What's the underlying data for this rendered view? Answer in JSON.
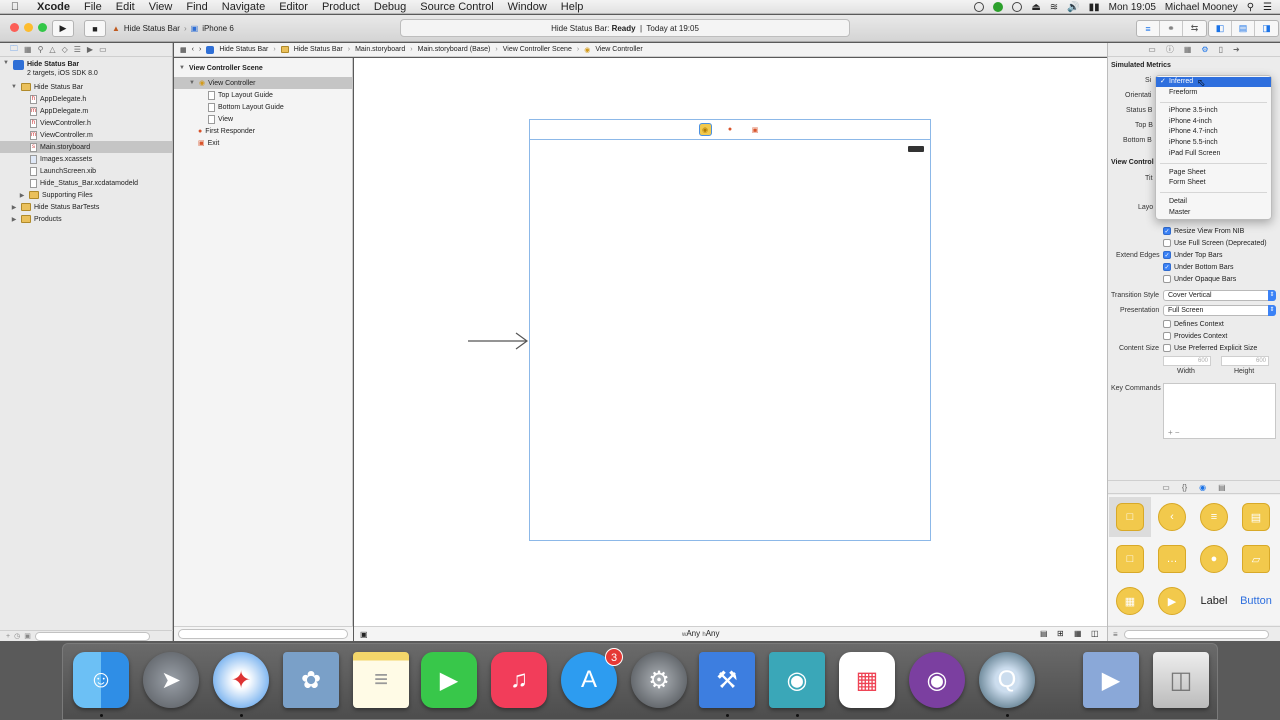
{
  "menubar": {
    "app_name": "Xcode",
    "items": [
      "File",
      "Edit",
      "View",
      "Find",
      "Navigate",
      "Editor",
      "Product",
      "Debug",
      "Source Control",
      "Window",
      "Help"
    ],
    "clock": "Mon 19:05",
    "user": "Michael Mooney"
  },
  "toolbar": {
    "scheme": "Hide Status Bar",
    "device": "iPhone 6",
    "activity_project": "Hide Status Bar:",
    "activity_status": "Ready",
    "activity_time": "Today at 19:05"
  },
  "navigator": {
    "project_name": "Hide Status Bar",
    "project_sub": "2 targets, iOS SDK 8.0",
    "group": "Hide Status Bar",
    "files": [
      "AppDelegate.h",
      "AppDelegate.m",
      "ViewController.h",
      "ViewController.m",
      "Main.storyboard",
      "Images.xcassets",
      "LaunchScreen.xib",
      "Hide_Status_Bar.xcdatamodeld"
    ],
    "folders": [
      "Supporting Files",
      "Hide Status BarTests",
      "Products"
    ]
  },
  "jumpbar": {
    "crumbs": [
      "Hide Status Bar",
      "Hide Status Bar",
      "Main.storyboard",
      "Main.storyboard (Base)",
      "View Controller Scene",
      "View Controller"
    ]
  },
  "outline": {
    "scene": "View Controller Scene",
    "controller": "View Controller",
    "children": [
      "Top Layout Guide",
      "Bottom Layout Guide",
      "View"
    ],
    "first_responder": "First Responder",
    "exit": "Exit"
  },
  "size_class": {
    "w": "w",
    "w_value": "Any",
    "h": "h",
    "h_value": "Any"
  },
  "inspector": {
    "simulated_metrics": "Simulated Metrics",
    "labels_hidden": [
      "Si",
      "Orientati",
      "Status B",
      "Top B",
      "Bottom B"
    ],
    "view_controller": "View Control",
    "title_label": "Tit",
    "layout_label": "Layo",
    "resize_from_nib": "Resize View From NIB",
    "use_full_screen": "Use Full Screen (Deprecated)",
    "extend_edges": "Extend Edges",
    "under_top_bars": "Under Top Bars",
    "under_bottom_bars": "Under Bottom Bars",
    "under_opaque_bars": "Under Opaque Bars",
    "transition_style_label": "Transition Style",
    "transition_style": "Cover Vertical",
    "presentation_label": "Presentation",
    "presentation": "Full Screen",
    "defines_context": "Defines Context",
    "provides_context": "Provides Context",
    "content_size_label": "Content Size",
    "use_preferred": "Use Preferred Explicit Size",
    "width_value": "600",
    "height_value": "600",
    "width_label": "Width",
    "height_label": "Height",
    "key_commands": "Key Commands",
    "add_remove": "+ −"
  },
  "dropdown": {
    "selected": "Inferred",
    "group1": [
      "Freeform"
    ],
    "group2": [
      "iPhone 3.5-inch",
      "iPhone 4-inch",
      "iPhone 4.7-inch",
      "iPhone 5.5-inch",
      "iPad Full Screen"
    ],
    "group3": [
      "Page Sheet",
      "Form Sheet"
    ],
    "group4": [
      "Detail",
      "Master"
    ]
  },
  "library": {
    "label_item": "Label",
    "button_item": "Button"
  },
  "dock": {
    "appstore_badge": "3"
  },
  "colors": {
    "accent": "#2e6fde",
    "storyboard_frame": "#8cb8e8",
    "library_yellow": "#f2c94c"
  }
}
